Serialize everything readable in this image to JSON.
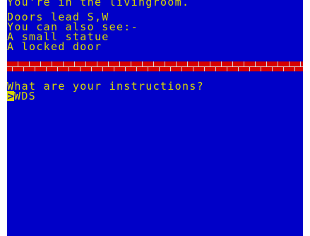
{
  "game": {
    "location_line": "You're in the livingroom.",
    "exits_line": "Doors lead S,W",
    "also_see_line": "You can also see:-",
    "items": [
      "A small statue",
      "A locked door"
    ],
    "prompt_line": "What are your instructions?",
    "cursor_symbol": ">",
    "typed_command": "WDS"
  },
  "colors": {
    "border": "#ffffff",
    "paper": "#0000c8",
    "ink": "#d7d700",
    "brick": "#d70000",
    "mortar": "#d7d7d7"
  }
}
